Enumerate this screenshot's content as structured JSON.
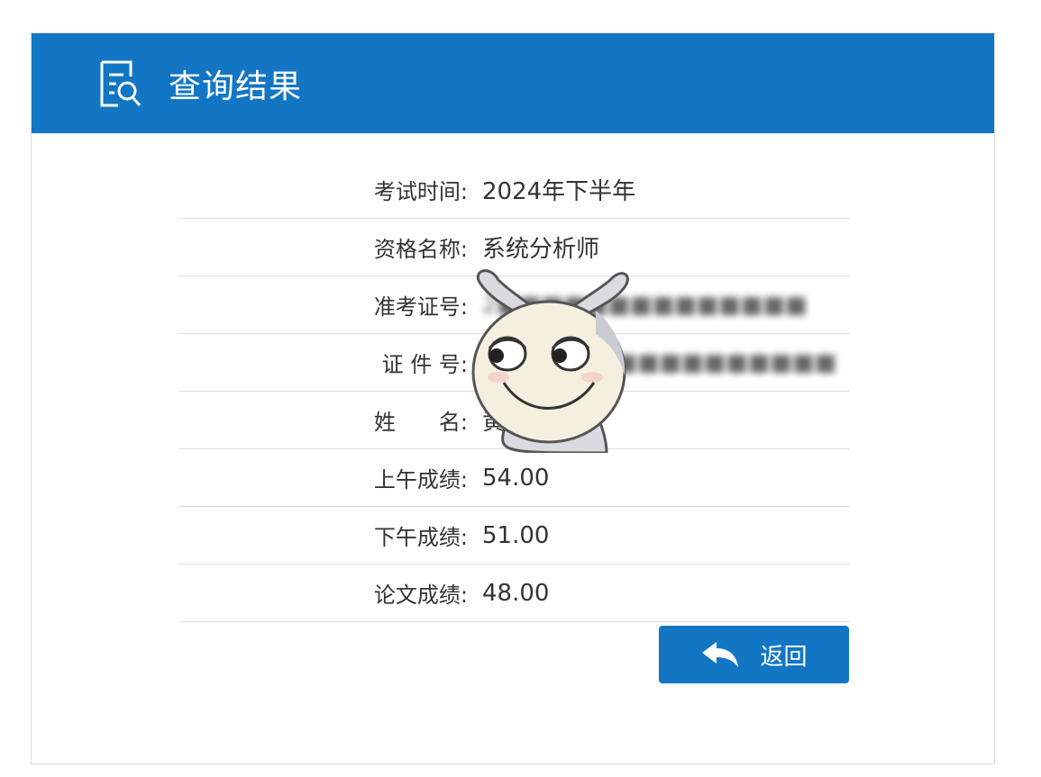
{
  "header": {
    "title": "查询结果",
    "icon": "search-document-icon"
  },
  "results": [
    {
      "label": "考试时间:",
      "value": "2024年下半年"
    },
    {
      "label": "资格名称:",
      "value": "系统分析师"
    },
    {
      "label": "准考证号:",
      "value": "2■■■■■■■■■■■■■■"
    },
    {
      "label": "证 件 号:",
      "value": "■■■■■■■■■■■■■■■■"
    },
    {
      "label": "姓　　名:",
      "value": "黄■"
    },
    {
      "label": "上午成绩:",
      "value": "54.00"
    },
    {
      "label": "下午成绩:",
      "value": "51.00"
    },
    {
      "label": "论文成绩:",
      "value": "48.00"
    }
  ],
  "actions": {
    "back_label": "返回",
    "back_icon": "reply-arrow-icon"
  },
  "colors": {
    "primary": "#1276c4",
    "text": "#333333",
    "divider": "#dddddd"
  }
}
